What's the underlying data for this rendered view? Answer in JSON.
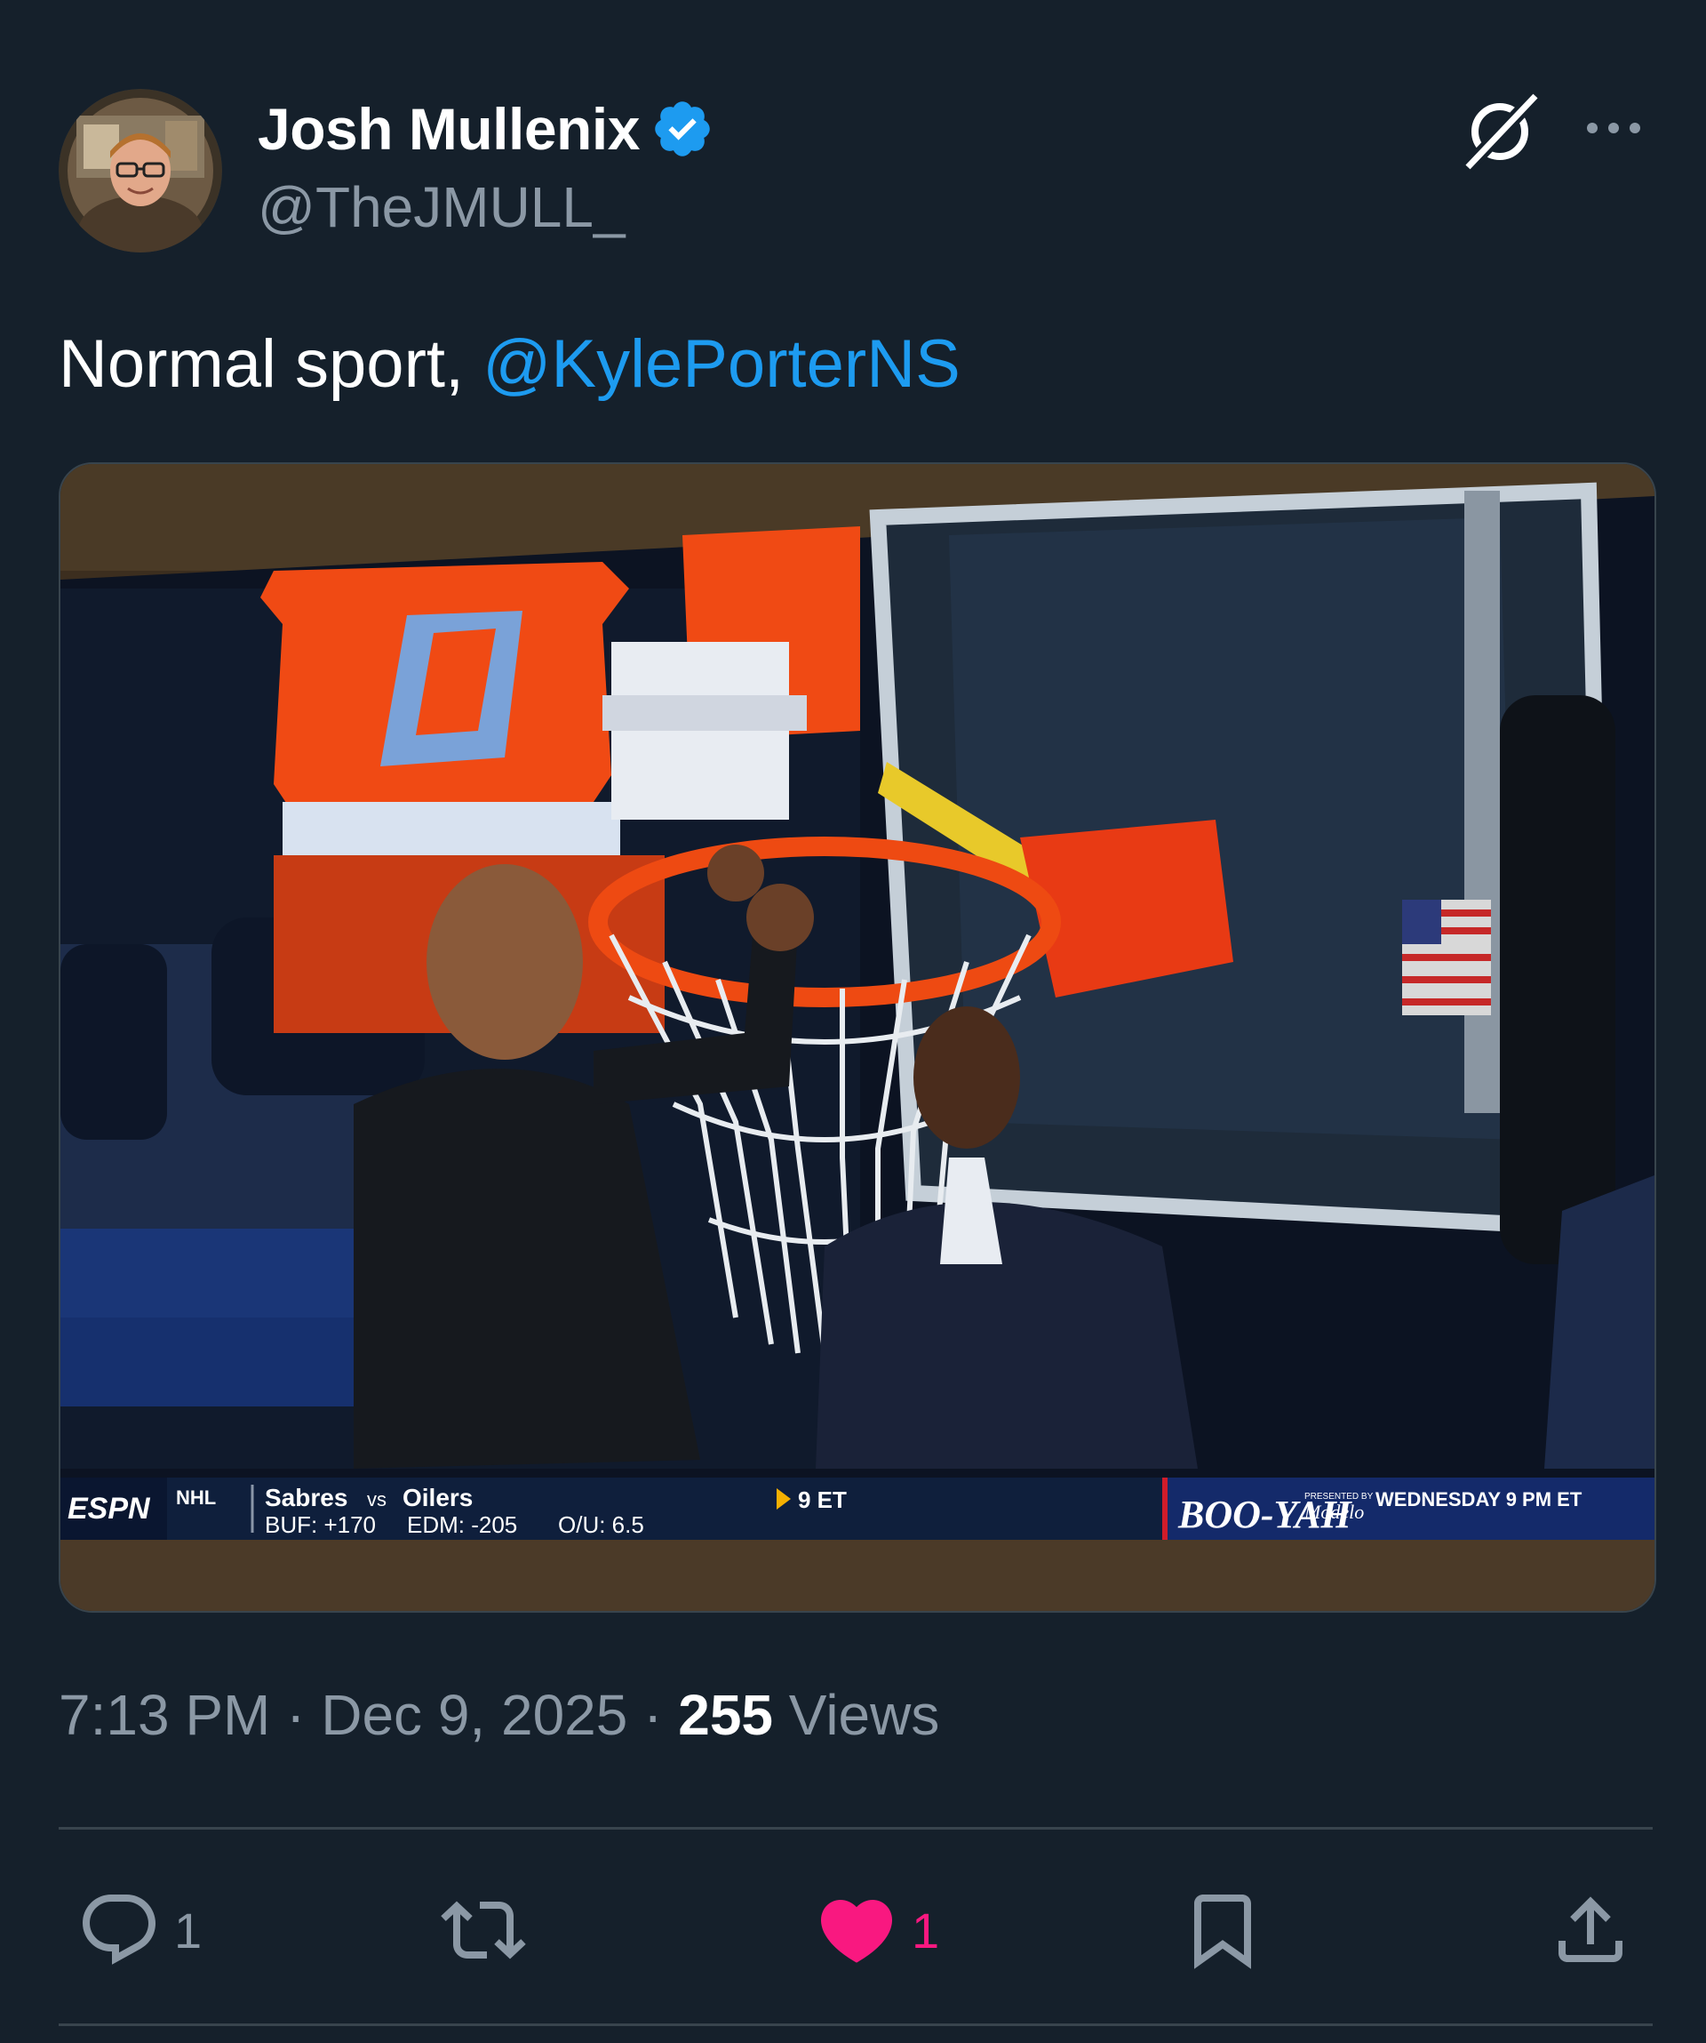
{
  "author": {
    "display_name": "Josh Mullenix",
    "handle": "@TheJMULL_",
    "verified": true
  },
  "header_icons": [
    "grok-icon",
    "more-icon"
  ],
  "tweet": {
    "text_prefix": "Normal sport, ",
    "mention": "@KylePorterNS"
  },
  "media": {
    "scoreboard": {
      "network": "ESPN",
      "league": "NHL",
      "matchup_home": "Sabres",
      "matchup_vs": "vs",
      "matchup_away": "Oilers",
      "line_buf": "BUF: +170",
      "line_edm": "EDM: -205",
      "line_ou": "O/U: 6.5",
      "time": "9 ET",
      "promo_title": "BOO-YAH",
      "promo_presented": "PRESENTED BY",
      "promo_sponsor": "Modelo",
      "promo_time": "WEDNESDAY 9 PM ET"
    }
  },
  "meta": {
    "time": "7:13 PM",
    "separator": " · ",
    "date": "Dec 9, 2025",
    "views_count": "255",
    "views_label": " Views"
  },
  "actions": {
    "reply_count": "1",
    "retweet_count": "",
    "like_count": "1",
    "like_color": "#f91880"
  },
  "colors": {
    "background": "#15202b",
    "accent": "#1d9bf0",
    "secondary_text": "#8b98a5",
    "divider": "#38444d"
  }
}
